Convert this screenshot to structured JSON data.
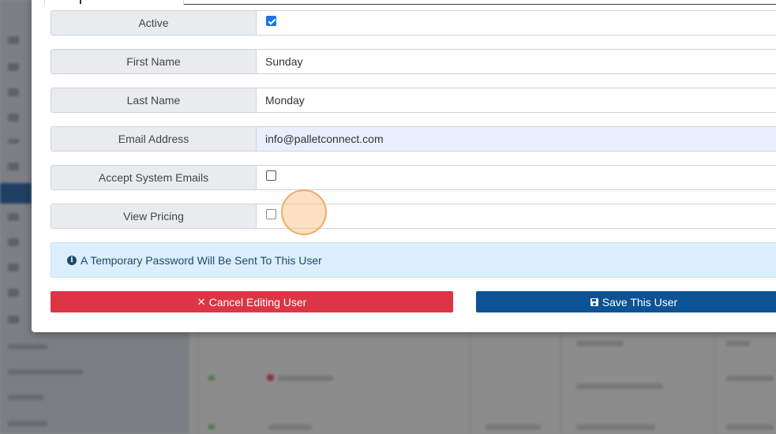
{
  "form": {
    "fields": [
      {
        "label": "Active",
        "type": "checkbox",
        "checked": true
      },
      {
        "label": "First Name",
        "type": "text",
        "value": "Sunday"
      },
      {
        "label": "Last Name",
        "type": "text",
        "value": "Monday"
      },
      {
        "label": "Email Address",
        "type": "text",
        "value": "info@palletconnect.com"
      },
      {
        "label": "Accept System Emails",
        "type": "checkbox",
        "checked": false
      },
      {
        "label": "View Pricing",
        "type": "checkbox",
        "checked": false
      }
    ]
  },
  "notice": {
    "icon": "info-circle-icon",
    "text": "A Temporary Password Will Be Sent To This User"
  },
  "actions": {
    "cancel_icon": "times-icon",
    "cancel_label": "Cancel Editing User",
    "save_icon": "floppy-disk-icon",
    "save_label": "Save This User"
  },
  "colors": {
    "danger": "#dc3545",
    "primary": "#0b5394",
    "info_bg": "#dbeefb",
    "info_text": "#1f4a6b",
    "autofill_bg": "#e8f0fe",
    "checkbox_checked": "#1a73e8"
  }
}
